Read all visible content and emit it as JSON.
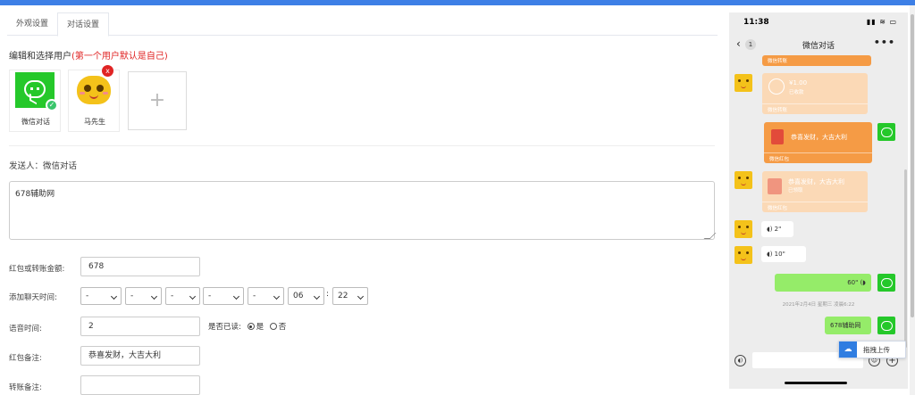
{
  "tabs": [
    "外观设置",
    "对话设置"
  ],
  "section_title": "编辑和选择用户",
  "section_note": "(第一个用户默认是自己)",
  "users": [
    {
      "label": "微信对话",
      "icon": "wechat-avatar-icon"
    },
    {
      "label": "马先生",
      "icon": "emoji-avatar-icon"
    }
  ],
  "add_symbol": "+",
  "sender_text": "发送人：微信对话",
  "message_text": "678辅助网",
  "form": {
    "amount_label": "红包或转账金额:",
    "amount_value": "678",
    "time_label": "添加聊天时间:",
    "selects": [
      "-",
      "-",
      "-",
      "-",
      "-",
      "06",
      "22"
    ],
    "colon": ":",
    "voice_label": "语音时间:",
    "voice_value": "2",
    "read_label": "是否已读:",
    "read_yes": "是",
    "read_no": "否",
    "hongbao_note_label": "红包备注:",
    "hongbao_note_value": "恭喜发财，大吉大利",
    "transfer_note_label": "转账备注:",
    "transfer_note_value": ""
  },
  "phone": {
    "time": "11:38",
    "status_icons": "▮▮ ≋ ▭",
    "back_count": "1",
    "title": "微信对话",
    "more": "•••",
    "messages": {
      "transfer_top_foot": "微信转账",
      "transfer_amount": "¥1.00",
      "transfer_status": "已收款",
      "transfer_foot": "微信转账",
      "hongbao_text": "恭喜发财，大吉大利",
      "hongbao_foot": "微信红包",
      "hongbao_received_text": "恭喜发财，大吉大利",
      "hongbao_received_status": "已领取",
      "hongbao_received_foot": "微信红包",
      "voice_1": "2\"",
      "voice_2": "10\"",
      "voice_3": "60\"",
      "timestamp": "2021年2月4日 星期三 凌晨6:22",
      "text_msg": "678辅助网"
    }
  },
  "upload_label": "拖拽上传",
  "colors": {
    "topbar": "#3d7fe6",
    "wechat_green": "#25c82a",
    "hongbao_orange": "#f59b45",
    "received_orange": "#fbd9b6",
    "bubble_green": "#95ec69",
    "note_red": "#e02424"
  }
}
